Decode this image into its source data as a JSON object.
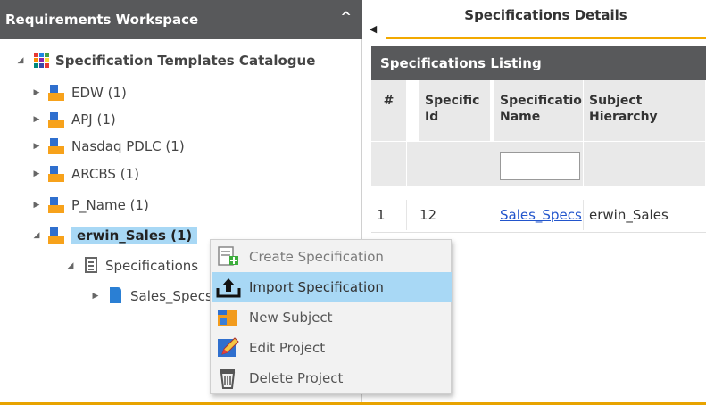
{
  "workspace": {
    "title": "Requirements Workspace",
    "tree": {
      "root_label": "Specification Templates Catalogue",
      "projects": [
        {
          "label": "EDW (1)"
        },
        {
          "label": "APJ (1)"
        },
        {
          "label": "Nasdaq PDLC (1)"
        },
        {
          "label": "ARCBS (1)"
        },
        {
          "label": "P_Name (1)"
        }
      ],
      "selected_project": "erwin_Sales (1)",
      "child_folder": "Specifications",
      "child_item": "Sales_Specs"
    }
  },
  "tab": {
    "label": "Specifications Details"
  },
  "listing": {
    "title": "Specifications Listing",
    "columns": [
      "#",
      "Specific Id",
      "Specificatio Name",
      "Subject Hierarchy"
    ],
    "rows": [
      {
        "num": "1",
        "id": "12",
        "name": "Sales_Specs",
        "subject": "erwin_Sales"
      }
    ]
  },
  "context_menu": {
    "items": [
      {
        "label": "Create Specification",
        "icon": "create-spec-icon"
      },
      {
        "label": "Import Specification",
        "icon": "import-icon"
      },
      {
        "label": "New Subject",
        "icon": "subject-icon"
      },
      {
        "label": "Edit Project",
        "icon": "edit-icon"
      },
      {
        "label": "Delete Project",
        "icon": "trash-icon"
      }
    ],
    "highlighted_index": 1
  },
  "colors": {
    "header_bg": "#58595b",
    "accent": "#f2a900",
    "selection": "#a8d8f5",
    "link": "#2255cc"
  }
}
